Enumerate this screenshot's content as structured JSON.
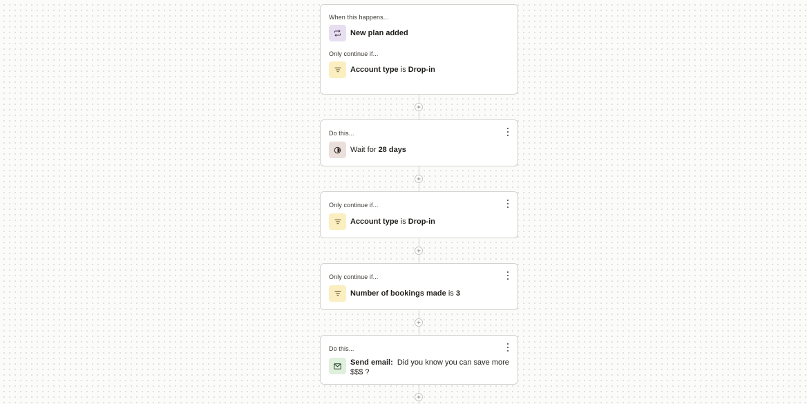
{
  "trigger_card": {
    "section_label": "When this happens...",
    "trigger_text": "New plan added",
    "trigger_icon": "repeat-icon",
    "condition_label": "Only continue if...",
    "condition": {
      "field": "Account type",
      "operator": "is",
      "value": "Drop-in"
    },
    "condition_icon": "filter-icon"
  },
  "wait_card": {
    "section_label": "Do this...",
    "prefix": "Wait for",
    "duration": "28 days",
    "icon": "timer-icon"
  },
  "filter_card_1": {
    "section_label": "Only continue if...",
    "field": "Account type",
    "operator": "is",
    "value": "Drop-in",
    "icon": "filter-icon"
  },
  "filter_card_2": {
    "section_label": "Only continue if...",
    "field": "Number of bookings made",
    "operator": "is",
    "value": "3",
    "icon": "filter-icon"
  },
  "email_card": {
    "section_label": "Do this...",
    "action": "Send email:",
    "subject": "Did you know you can save more $$$ ?",
    "icon": "email-icon"
  },
  "colors": {
    "trigger_icon_bg": "#e7def0",
    "filter_icon_bg": "#fbeec0",
    "wait_icon_bg": "#eadfdb",
    "email_icon_bg": "#dff0dc"
  }
}
